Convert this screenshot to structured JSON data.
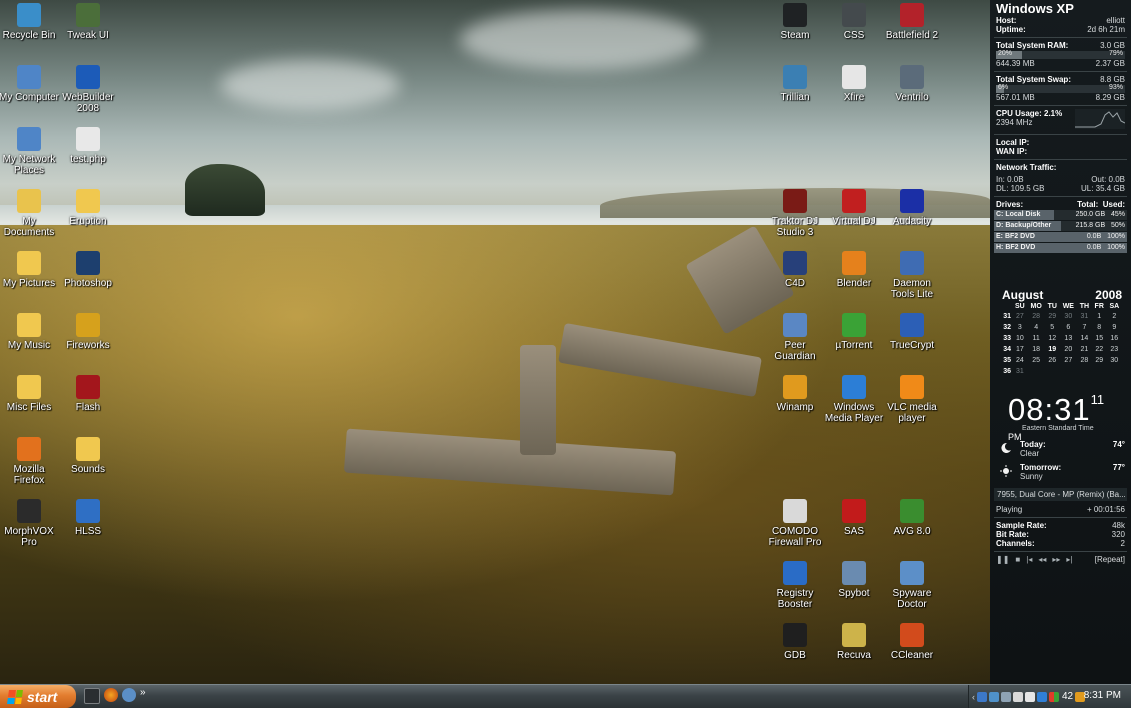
{
  "desktop": {
    "icons_left": [
      {
        "label": "Recycle Bin",
        "icon": "recycle-bin-icon",
        "color": "#3a8ec9"
      },
      {
        "label": "Tweak UI",
        "icon": "tweak-ui-icon",
        "color": "#4b6e3a"
      },
      {
        "label": "My Computer",
        "icon": "my-computer-icon",
        "color": "#4f85c7"
      },
      {
        "label": "WebBuilder 2008",
        "icon": "webbuilder-icon",
        "color": "#1c5bb8"
      },
      {
        "label": "My Network Places",
        "icon": "network-places-icon",
        "color": "#4f85c7"
      },
      {
        "label": "test.php",
        "icon": "php-file-icon",
        "color": "#e8e8e8"
      },
      {
        "label": "My Documents",
        "icon": "my-documents-icon",
        "color": "#e9c34d"
      },
      {
        "label": "Eruption",
        "icon": "folder-icon",
        "color": "#f0c84f"
      },
      {
        "label": "My Pictures",
        "icon": "folder-icon",
        "color": "#f0c84f"
      },
      {
        "label": "Photoshop",
        "icon": "photoshop-icon",
        "color": "#1d3f6e"
      },
      {
        "label": "My Music",
        "icon": "folder-icon",
        "color": "#f0c84f"
      },
      {
        "label": "Fireworks",
        "icon": "fireworks-icon",
        "color": "#d6a11c"
      },
      {
        "label": "Misc Files",
        "icon": "folder-icon",
        "color": "#f0c84f"
      },
      {
        "label": "Flash",
        "icon": "flash-icon",
        "color": "#a3161c"
      },
      {
        "label": "Mozilla Firefox",
        "icon": "firefox-icon",
        "color": "#e2711d"
      },
      {
        "label": "Sounds",
        "icon": "folder-icon",
        "color": "#f0c84f"
      },
      {
        "label": "MorphVOX Pro",
        "icon": "morphvox-icon",
        "color": "#2b2b2b"
      },
      {
        "label": "HLSS",
        "icon": "hlss-icon",
        "color": "#2f6fc4"
      }
    ],
    "icons_right": [
      {
        "label": "Steam",
        "icon": "steam-icon",
        "color": "#1f2224"
      },
      {
        "label": "CSS",
        "icon": "css-game-icon",
        "color": "#444a4d"
      },
      {
        "label": "Battlefield 2",
        "icon": "battlefield-icon",
        "color": "#b3222a"
      },
      {
        "label": "Trillian",
        "icon": "trillian-icon",
        "color": "#3b7fb3"
      },
      {
        "label": "Xfire",
        "icon": "xfire-icon",
        "color": "#e6e6e6"
      },
      {
        "label": "Ventrilo",
        "icon": "ventrilo-icon",
        "color": "#5b6b7a"
      },
      {
        "label": "Traktor DJ Studio 3",
        "icon": "traktor-icon",
        "color": "#7a1b16"
      },
      {
        "label": "Virtual DJ",
        "icon": "virtual-dj-icon",
        "color": "#c11f1f"
      },
      {
        "label": "Audacity",
        "icon": "audacity-icon",
        "color": "#1b2fa6"
      },
      {
        "label": "C4D",
        "icon": "cinema4d-icon",
        "color": "#27407a"
      },
      {
        "label": "Blender",
        "icon": "blender-icon",
        "color": "#e5811c"
      },
      {
        "label": "Daemon Tools Lite",
        "icon": "daemon-tools-icon",
        "color": "#3f6cb3"
      },
      {
        "label": "Peer Guardian",
        "icon": "peer-guardian-icon",
        "color": "#5a87c4"
      },
      {
        "label": "µTorrent",
        "icon": "utorrent-icon",
        "color": "#3aa236"
      },
      {
        "label": "TrueCrypt",
        "icon": "truecrypt-icon",
        "color": "#2c5fb6"
      },
      {
        "label": "Winamp",
        "icon": "winamp-icon",
        "color": "#e09a1e"
      },
      {
        "label": "Windows Media Player",
        "icon": "media-player-icon",
        "color": "#2c7ed6"
      },
      {
        "label": "VLC media player",
        "icon": "vlc-icon",
        "color": "#f08a18"
      },
      {
        "label": "COMODO Firewall Pro",
        "icon": "comodo-icon",
        "color": "#d9d9d9"
      },
      {
        "label": "SAS",
        "icon": "sas-icon",
        "color": "#c21b1b"
      },
      {
        "label": "AVG 8.0",
        "icon": "avg-icon",
        "color": "#3a8d2f"
      },
      {
        "label": "Registry Booster",
        "icon": "registry-booster-icon",
        "color": "#2a6cc6"
      },
      {
        "label": "Spybot",
        "icon": "spybot-icon",
        "color": "#6a8bb0"
      },
      {
        "label": "Spyware Doctor",
        "icon": "spyware-doctor-icon",
        "color": "#5c8fc8"
      },
      {
        "label": "GDB",
        "icon": "gdb-icon",
        "color": "#1f1f1f"
      },
      {
        "label": "Recuva",
        "icon": "recuva-icon",
        "color": "#cdb34a"
      },
      {
        "label": "CCleaner",
        "icon": "ccleaner-icon",
        "color": "#d24b1c"
      }
    ]
  },
  "sidebar": {
    "title": "Windows XP",
    "host_label": "Host:",
    "host_value": "elliott",
    "uptime_label": "Uptime:",
    "uptime_value": "2d 6h 21m",
    "ram": {
      "label": "Total System RAM:",
      "total": "3.0 GB",
      "used_pct_label": "20%",
      "free_pct_label": "79%",
      "used_fraction": 0.2,
      "used": "644.39 MB",
      "free": "2.37 GB"
    },
    "swap": {
      "label": "Total System Swap:",
      "total": "8.8 GB",
      "used_pct_label": "6%",
      "free_pct_label": "93%",
      "used_fraction": 0.06,
      "used": "567.01 MB",
      "free": "8.29 GB"
    },
    "cpu": {
      "label": "CPU Usage: 2.1%",
      "freq": "2394 MHz"
    },
    "local_ip_label": "Local IP:",
    "wan_ip_label": "WAN IP:",
    "network": {
      "label": "Network Traffic:",
      "in": "In: 0.0B",
      "out": "Out: 0.0B",
      "dl": "DL: 109.5 GB",
      "ul": "UL: 35.4 GB"
    },
    "drives_label": "Drives:",
    "drives_total_label": "Total:",
    "drives_used_label": "Used:",
    "drives": [
      {
        "name": "C: Local Disk",
        "total": "250.0 GB",
        "used": "45%",
        "fraction": 0.45
      },
      {
        "name": "D: Backup/Other",
        "total": "215.8 GB",
        "used": "50%",
        "fraction": 0.5
      },
      {
        "name": "E: BF2 DVD",
        "total": "0.0B",
        "used": "100%",
        "fraction": 1.0
      },
      {
        "name": "H: BF2 DVD",
        "total": "0.0B",
        "used": "100%",
        "fraction": 1.0
      }
    ],
    "calendar": {
      "month": "August",
      "year": "2008",
      "weekdays": [
        "SU",
        "MO",
        "TU",
        "WE",
        "TH",
        "FR",
        "SA"
      ],
      "weeks": [
        {
          "wk": "31",
          "days": [
            "27",
            "28",
            "29",
            "30",
            "31",
            "1",
            "2"
          ]
        },
        {
          "wk": "32",
          "days": [
            "3",
            "4",
            "5",
            "6",
            "7",
            "8",
            "9"
          ]
        },
        {
          "wk": "33",
          "days": [
            "10",
            "11",
            "12",
            "13",
            "14",
            "15",
            "16"
          ]
        },
        {
          "wk": "34",
          "days": [
            "17",
            "18",
            "19",
            "20",
            "21",
            "22",
            "23"
          ]
        },
        {
          "wk": "35",
          "days": [
            "24",
            "25",
            "26",
            "27",
            "28",
            "29",
            "30"
          ]
        },
        {
          "wk": "36",
          "days": [
            "31",
            "",
            "",
            "",
            "",
            "",
            ""
          ]
        }
      ],
      "today": "19"
    },
    "clock": {
      "time": "08:31",
      "seconds": "11",
      "ampm": "PM",
      "timezone": "Eastern Standard Time"
    },
    "weather": [
      {
        "label": "Today:",
        "desc": "Clear",
        "temp": "74°",
        "icon": "moon-icon"
      },
      {
        "label": "Tomorrow:",
        "desc": "Sunny",
        "temp": "77°",
        "icon": "sun-icon"
      }
    ],
    "player": {
      "track": "7955, Dual Core - MP (Remix) (Ba...",
      "status": "Playing",
      "time": "+ 00:01:56",
      "sample_rate_label": "Sample Rate:",
      "sample_rate": "48k",
      "bit_rate_label": "Bit Rate:",
      "bit_rate": "320",
      "channels_label": "Channels:",
      "channels": "2",
      "repeat": "[Repeat]"
    }
  },
  "taskbar": {
    "start_label": "start",
    "tray_number": "42",
    "clock": "8:31 PM"
  }
}
